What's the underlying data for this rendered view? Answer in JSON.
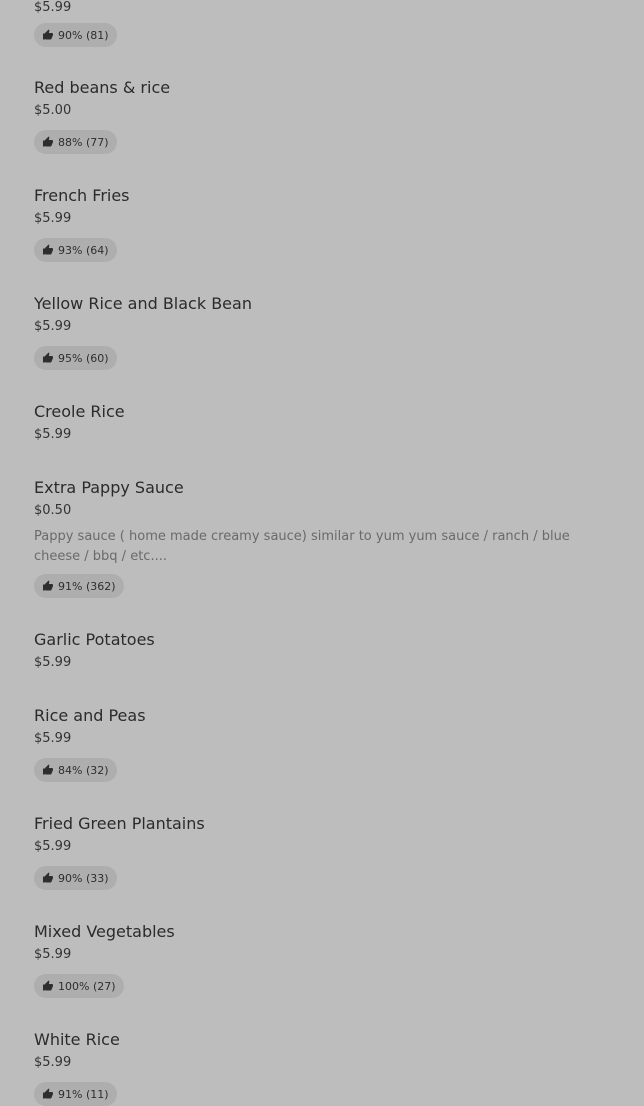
{
  "items": [
    {
      "name": "",
      "price": "$5.99",
      "rating": "90% (81)"
    },
    {
      "name": "Red beans & rice",
      "price": "$5.00",
      "rating": "88% (77)"
    },
    {
      "name": "French Fries",
      "price": "$5.99",
      "rating": "93% (64)"
    },
    {
      "name": "Yellow Rice and Black Bean",
      "price": "$5.99",
      "rating": "95% (60)"
    },
    {
      "name": "Creole Rice",
      "price": "$5.99"
    },
    {
      "name": "Extra Pappy Sauce",
      "price": "$0.50",
      "description": "Pappy sauce ( home made creamy sauce) similar to yum yum sauce / ranch / blue cheese / bbq / etc....",
      "rating": "91% (362)"
    },
    {
      "name": "Garlic Potatoes",
      "price": "$5.99"
    },
    {
      "name": "Rice and Peas",
      "price": "$5.99",
      "rating": "84% (32)"
    },
    {
      "name": "Fried Green Plantains",
      "price": "$5.99",
      "rating": "90% (33)"
    },
    {
      "name": "Mixed Vegetables",
      "price": "$5.99",
      "rating": "100% (27)"
    },
    {
      "name": "White Rice",
      "price": "$5.99",
      "rating": "91% (11)"
    }
  ],
  "icons": {
    "rating": "thumbs-up-icon"
  }
}
